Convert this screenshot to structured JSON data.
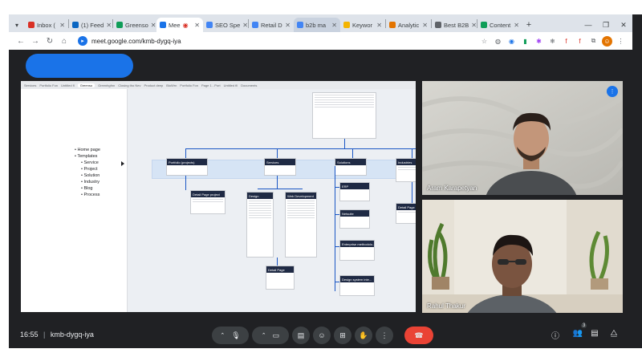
{
  "browser": {
    "tabs": [
      {
        "label": "Inbox (",
        "color": "#d93025"
      },
      {
        "label": "(1) Feed",
        "color": "#0a66c2"
      },
      {
        "label": "Greenso",
        "color": "#0f9d58"
      },
      {
        "label": "Mee",
        "color": "#1a73e8",
        "active": true
      },
      {
        "label": "SEO Spe",
        "color": "#4285f4"
      },
      {
        "label": "Retail D",
        "color": "#4285f4"
      },
      {
        "label": "b2b ma",
        "color": "#4285f4"
      },
      {
        "label": "Keywor",
        "color": "#f4b400"
      },
      {
        "label": "Analytic",
        "color": "#e37400"
      },
      {
        "label": "Best B2B",
        "color": "#5f6368"
      },
      {
        "label": "Content",
        "color": "#0f9d58"
      }
    ],
    "url": "meet.google.com/kmb-dygq-iya"
  },
  "share": {
    "file_tabs": [
      "Services",
      "Portfolio Fon",
      "Untitled fl",
      "Greenso",
      "Greenhgfnn",
      "Closing tho Nev",
      "Product deep",
      "BioWrn",
      "Portfolio Fon",
      "Page 1 - Port",
      "Untitled fil",
      "Documents"
    ],
    "sitemap": [
      {
        "label": "Home page",
        "level": 1
      },
      {
        "label": "Templates",
        "level": 1
      },
      {
        "label": "Service",
        "level": 2
      },
      {
        "label": "Project",
        "level": 2
      },
      {
        "label": "Solution",
        "level": 2
      },
      {
        "label": "Industry",
        "level": 2
      },
      {
        "label": "Blog",
        "level": 2
      },
      {
        "label": "Process",
        "level": 2
      }
    ],
    "nodes": {
      "portfolio": "Portfolio (projects)",
      "services": "Services",
      "solutions": "Solutions",
      "industries": "Industries",
      "detail_project": "Detail Page project",
      "design": "Design",
      "webdev": "Web Development",
      "erp": "ERP",
      "netsuite": "Netsuite",
      "enterprise": "Enterprise methodolo...",
      "design_system": "Design system inte...",
      "detail": "Detail Page",
      "detail2": "Detail Page"
    }
  },
  "participants": [
    {
      "name": "Aram Karapetyan",
      "speaking": true
    },
    {
      "name": "Rahul Thakur"
    }
  ],
  "meeting": {
    "time": "16:55",
    "separator": "|",
    "code": "kmb-dygq-iya",
    "participant_count": "3"
  },
  "colors": {
    "accent": "#1a73e8",
    "end_call": "#ea4335",
    "surface": "#202124"
  }
}
